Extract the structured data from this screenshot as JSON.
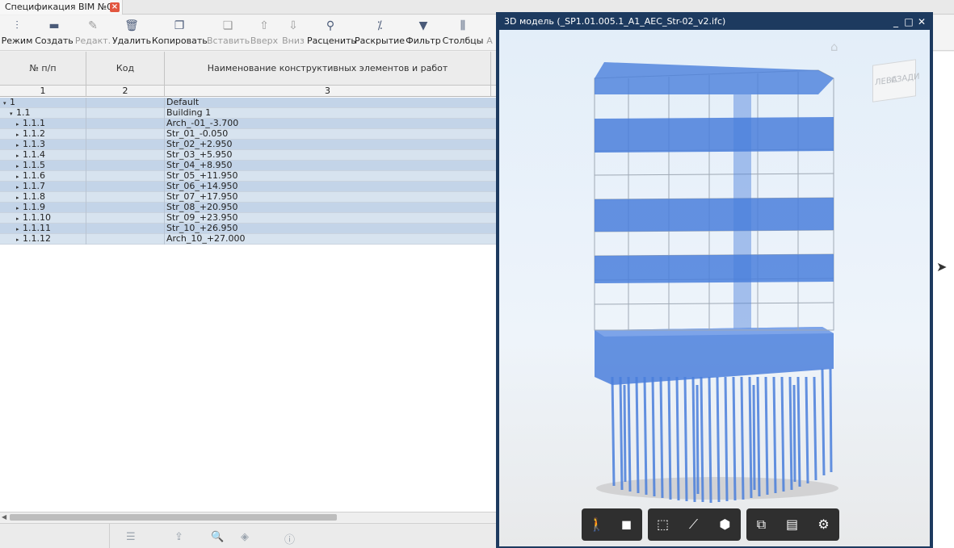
{
  "tab": {
    "title": "Спецификация BIM №0",
    "close": "×"
  },
  "toolbar": {
    "buttons": [
      {
        "label": "Режим",
        "icon": "mode-icon",
        "glyph": "⫶",
        "disabled": false
      },
      {
        "label": "Создать",
        "icon": "create-icon",
        "glyph": "▬",
        "disabled": false
      },
      {
        "label": "Редакт.",
        "icon": "edit-icon",
        "glyph": "✎",
        "disabled": true
      },
      {
        "label": "Удалить",
        "icon": "delete-icon",
        "glyph": "🗑",
        "disabled": false
      },
      {
        "label": "Копировать",
        "icon": "copy-icon",
        "glyph": "❐",
        "disabled": false
      },
      {
        "label": "Вставить",
        "icon": "paste-icon",
        "glyph": "❏",
        "disabled": true
      },
      {
        "label": "Вверх",
        "icon": "arrow-up-icon",
        "glyph": "⇧",
        "disabled": true
      },
      {
        "label": "Вниз",
        "icon": "arrow-down-icon",
        "glyph": "⇩",
        "disabled": true
      },
      {
        "label": "Расценить",
        "icon": "price-icon",
        "glyph": "⚲",
        "disabled": false
      },
      {
        "label": "Раскрытие",
        "icon": "expand-icon",
        "glyph": "⁒",
        "disabled": false
      },
      {
        "label": "Фильтр",
        "icon": "filter-icon",
        "glyph": "▼",
        "disabled": false
      },
      {
        "label": "Столбцы",
        "icon": "columns-icon",
        "glyph": "⫼",
        "disabled": false
      },
      {
        "label": "А",
        "icon": "more-icon",
        "glyph": "",
        "disabled": true
      }
    ]
  },
  "grid": {
    "columns": [
      "№ п/п",
      "Код",
      "Наименование конструктивных элементов и работ"
    ],
    "column_numbers": [
      "1",
      "2",
      "3"
    ],
    "rows": [
      {
        "num": "1",
        "code": "",
        "name": "Default",
        "level": 0,
        "toggle": "▾"
      },
      {
        "num": "1.1",
        "code": "",
        "name": "Building 1",
        "level": 1,
        "toggle": "▾"
      },
      {
        "num": "1.1.1",
        "code": "",
        "name": "Arch_-01_-3.700",
        "level": 2,
        "toggle": "▸"
      },
      {
        "num": "1.1.2",
        "code": "",
        "name": "Str_01_-0.050",
        "level": 2,
        "toggle": "▸"
      },
      {
        "num": "1.1.3",
        "code": "",
        "name": "Str_02_+2.950",
        "level": 2,
        "toggle": "▸"
      },
      {
        "num": "1.1.4",
        "code": "",
        "name": "Str_03_+5.950",
        "level": 2,
        "toggle": "▸"
      },
      {
        "num": "1.1.5",
        "code": "",
        "name": "Str_04_+8.950",
        "level": 2,
        "toggle": "▸"
      },
      {
        "num": "1.1.6",
        "code": "",
        "name": "Str_05_+11.950",
        "level": 2,
        "toggle": "▸"
      },
      {
        "num": "1.1.7",
        "code": "",
        "name": "Str_06_+14.950",
        "level": 2,
        "toggle": "▸"
      },
      {
        "num": "1.1.8",
        "code": "",
        "name": "Str_07_+17.950",
        "level": 2,
        "toggle": "▸"
      },
      {
        "num": "1.1.9",
        "code": "",
        "name": "Str_08_+20.950",
        "level": 2,
        "toggle": "▸"
      },
      {
        "num": "1.1.10",
        "code": "",
        "name": "Str_09_+23.950",
        "level": 2,
        "toggle": "▸"
      },
      {
        "num": "1.1.11",
        "code": "",
        "name": "Str_10_+26.950",
        "level": 2,
        "toggle": "▸"
      },
      {
        "num": "1.1.12",
        "code": "",
        "name": "Arch_10_+27.000",
        "level": 2,
        "toggle": "▸"
      }
    ]
  },
  "statusbar": {
    "icons": [
      "list-icon",
      "upload-icon",
      "search-icon",
      "layers-icon",
      "info-icon"
    ]
  },
  "viewer": {
    "title": "3D модель (_SP1.01.005.1_A1_AEC_Str-02_v2.ifc)",
    "window_buttons": [
      "minimize",
      "maximize",
      "close"
    ],
    "viewcube": {
      "left": "ЛЕВА",
      "back": "СЗАДИ"
    },
    "nav_tools": [
      {
        "icon": "walk-icon",
        "glyph": "🚶"
      },
      {
        "icon": "camera-icon",
        "glyph": "▶"
      },
      {
        "icon": "section-box-icon",
        "glyph": "⬚"
      },
      {
        "icon": "measure-icon",
        "glyph": "📏"
      },
      {
        "icon": "explode-icon",
        "glyph": "⬢"
      },
      {
        "icon": "model-tree-icon",
        "glyph": "⧉"
      },
      {
        "icon": "properties-icon",
        "glyph": "▤"
      },
      {
        "icon": "settings-icon",
        "glyph": "⚙"
      }
    ]
  },
  "colors": {
    "accent_blue": "#4a7fdc",
    "title_bar": "#1d3a5f",
    "row_level0": "#c3d4e8",
    "row_level1": "#d7e3ef"
  }
}
